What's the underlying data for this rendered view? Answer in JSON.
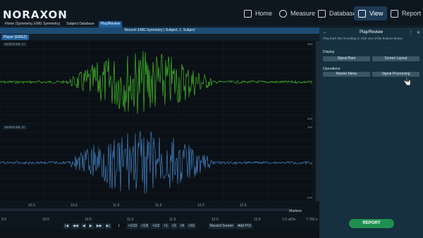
{
  "brand": "NORAXON",
  "nav": [
    {
      "label": "Home"
    },
    {
      "label": "Measure"
    },
    {
      "label": "Database"
    },
    {
      "label": "View"
    },
    {
      "label": "Report"
    }
  ],
  "breadcrumbs": [
    "Home (Symmetry, EMG Symmetry)",
    "Subject Database",
    "Play/Review"
  ],
  "record_title": "Record: EMG Symmetry | Subject, 1. Subject",
  "player_tab": "Player (EMG2)",
  "channels": [
    {
      "label": "BICEPS RR, 17",
      "color": "#4cd12b",
      "ymax": "500",
      "ymin": "-500",
      "mid": "0"
    },
    {
      "label": "BICEPS RR, 37",
      "color": "#4a90d9",
      "ymax": "500",
      "ymin": "-500",
      "mid": "0"
    }
  ],
  "x_ticks": [
    "10.0",
    "10.5",
    "11.0",
    "11.5",
    "12.0",
    "12.5"
  ],
  "x_ticks_lower": [
    "9.5",
    "10.0",
    "10.5",
    "11.0",
    "11.5",
    "12.0",
    "12.5"
  ],
  "units_lower": "1.0 s/Div",
  "elapsed": "7.782 s",
  "markers_label": "Markers",
  "controls": {
    "buttons": [
      "|◀",
      "◀◀",
      "◀",
      "▶",
      "▶▶",
      "▶|"
    ],
    "frame": "1",
    "speeds": [
      "×1/10",
      "×1/5",
      "×1/2",
      "×1",
      "×2",
      "×5",
      "×10"
    ],
    "record": "Record Screen",
    "add_poi": "Add POI"
  },
  "side": {
    "title": "Play/Review",
    "subtitle": "Play back the recording or click one of the buttons below.",
    "display": "Display",
    "signal_bars": "Signal Bars",
    "screen_layout": "Screen Layout",
    "operations": "Operations",
    "marker_menu": "Marker Menu",
    "signal_processing": "Signal Processing"
  },
  "report_button": "REPORT"
}
